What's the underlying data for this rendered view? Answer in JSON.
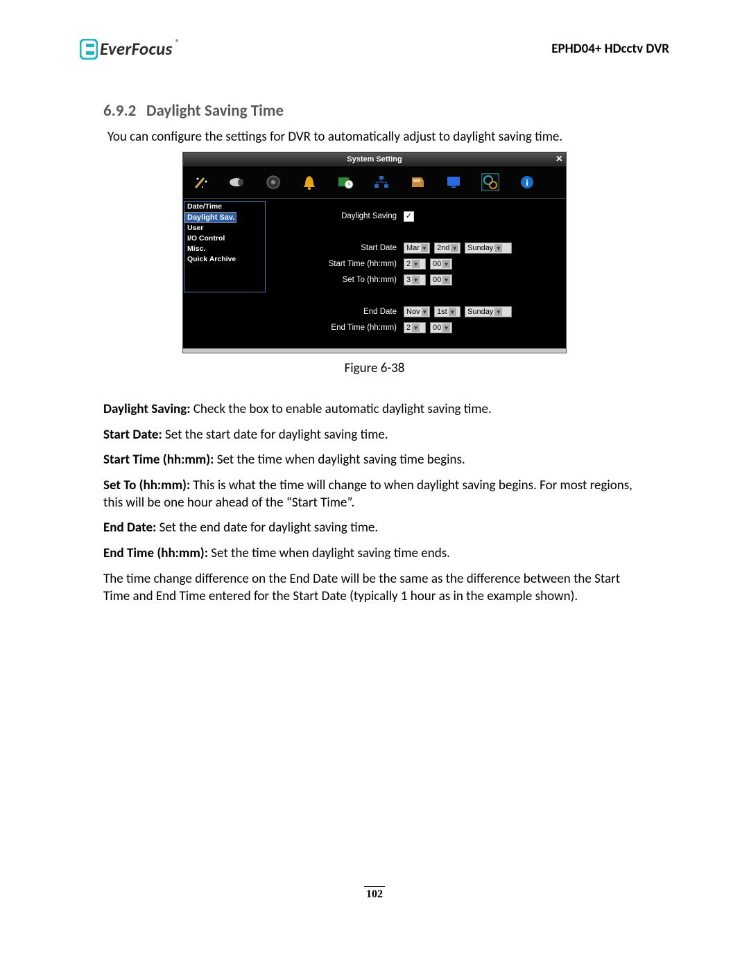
{
  "header": {
    "brand_text": "EverFocus",
    "product": "EPHD04+  HDcctv DVR"
  },
  "section": {
    "number": "6.9.2",
    "title": "Daylight Saving Time",
    "intro": "You can configure the settings for DVR to automatically adjust to daylight saving time."
  },
  "dvr": {
    "title": "System Setting",
    "sidebar": [
      "Date/Time",
      "Daylight Sav.",
      "User",
      "I/O Control",
      "Misc.",
      "Quick Archive"
    ],
    "selected_sidebar_index": 1,
    "fields": {
      "dst_label": "Daylight Saving",
      "dst_checked": true,
      "start_date_label": "Start Date",
      "start_month": "Mar",
      "start_week": "2nd",
      "start_day": "Sunday",
      "start_time_label": "Start Time (hh:mm)",
      "start_hh": "2",
      "start_mm": "00",
      "set_to_label": "Set To (hh:mm)",
      "set_to_hh": "3",
      "set_to_mm": "00",
      "end_date_label": "End Date",
      "end_month": "Nov",
      "end_week": "1st",
      "end_day": "Sunday",
      "end_time_label": "End Time (hh:mm)",
      "end_hh": "2",
      "end_mm": "00"
    }
  },
  "figure_caption": "Figure 6-38",
  "definitions": [
    {
      "term": "Daylight Saving:",
      "desc": " Check the box to enable automatic daylight saving time."
    },
    {
      "term": "Start Date:",
      "desc": " Set the start date for daylight saving time."
    },
    {
      "term": "Start Time (hh:mm):",
      "desc": " Set the time when daylight saving time begins."
    },
    {
      "term": "Set To (hh:mm):",
      "desc": " This is what the time will change to when daylight saving begins. For most regions, this will be one hour ahead of the “Start Time”."
    },
    {
      "term": "End Date:",
      "desc": " Set the end date for daylight saving time."
    },
    {
      "term": "End Time (hh:mm):",
      "desc": " Set the time when daylight saving time ends."
    }
  ],
  "closing": "The time change difference on the End Date will be the same as the difference between the Start Time and End Time entered for the Start Date (typically 1 hour as in the example shown).",
  "page_number": "102"
}
